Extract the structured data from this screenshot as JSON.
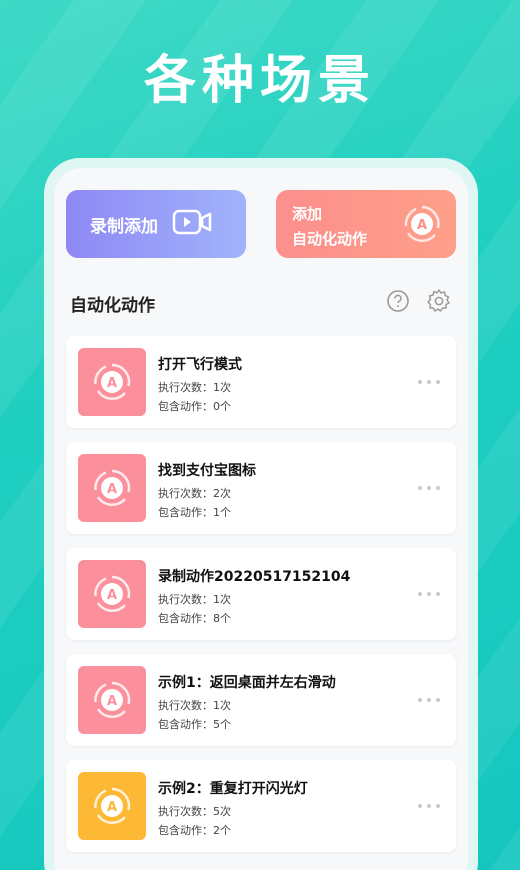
{
  "hero": {
    "title": "各种场景"
  },
  "actions": {
    "record_label": "录制添加",
    "add_label_line1": "添加",
    "add_label_line2": "自动化动作"
  },
  "section": {
    "title": "自动化动作"
  },
  "colors": {
    "thumb_default": "#fc8f9c",
    "thumb_alt": "#fdb835"
  },
  "automations": [
    {
      "title": "打开飞行模式",
      "exec": "执行次数：1次",
      "contains": "包含动作：0个",
      "color": "#fc8f9c"
    },
    {
      "title": "找到支付宝图标",
      "exec": "执行次数：2次",
      "contains": "包含动作：1个",
      "color": "#fc8f9c"
    },
    {
      "title": "录制动作20220517152104",
      "exec": "执行次数：1次",
      "contains": "包含动作：8个",
      "color": "#fc8f9c"
    },
    {
      "title": "示例1：返回桌面并左右滑动",
      "exec": "执行次数：1次",
      "contains": "包含动作：5个",
      "color": "#fc8f9c"
    },
    {
      "title": "示例2：重复打开闪光灯",
      "exec": "执行次数：5次",
      "contains": "包含动作：2个",
      "color": "#fdb835"
    }
  ]
}
